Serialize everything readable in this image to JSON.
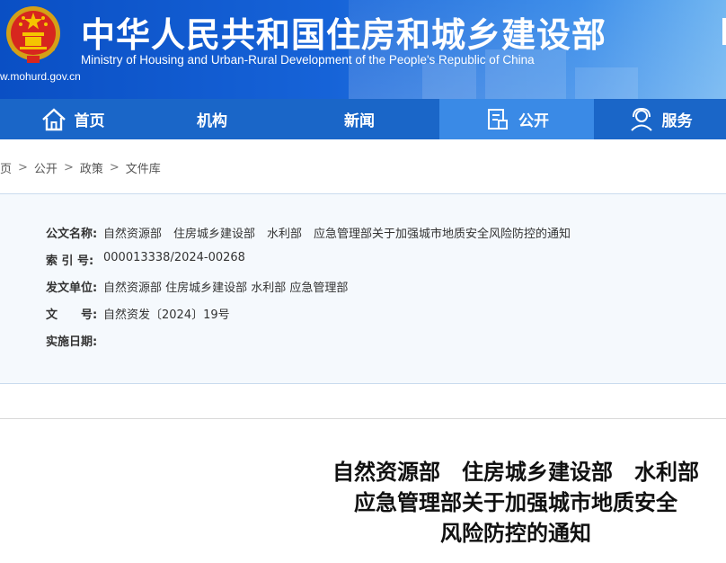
{
  "header": {
    "title": "中华人民共和国住房和城乡建设部",
    "subtitle": "Ministry of Housing and Urban-Rural Development of the People's Republic of China",
    "url": "w.mohurd.gov.cn",
    "emblem_icon": "national-emblem-icon"
  },
  "nav": {
    "items": [
      {
        "label": "首页",
        "icon": "home-icon"
      },
      {
        "label": "机构",
        "icon": ""
      },
      {
        "label": "新闻",
        "icon": ""
      },
      {
        "label": "公开",
        "icon": "document-icon",
        "active": true
      },
      {
        "label": "服务",
        "icon": "user-service-icon"
      }
    ]
  },
  "breadcrumb": {
    "items": [
      "页",
      "公开",
      "政策",
      "文件库"
    ],
    "separator": ">"
  },
  "info": {
    "title_label": "公文名称:",
    "title_value": "自然资源部　住房城乡建设部　水利部　应急管理部关于加强城市地质安全风险防控的通知",
    "index_label": "索 引 号:",
    "index_value": "000013338/2024-00268",
    "issuer_label": "发文单位:",
    "issuer_value": "自然资源部 住房城乡建设部 水利部 应急管理部",
    "docno_label": "文　　号:",
    "docno_value": "自然资发〔2024〕19号",
    "date_label": "实施日期:",
    "date_value": ""
  },
  "document": {
    "title_line1": "自然资源部　住房城乡建设部　水利部",
    "title_line2": "应急管理部关于加强城市地质安全",
    "title_line3": "风险防控的通知"
  },
  "colors": {
    "banner": "#1663d8",
    "nav": "#1a66c8",
    "nav_active": "#3a8ae6",
    "info_bg": "#f5f9fd"
  }
}
